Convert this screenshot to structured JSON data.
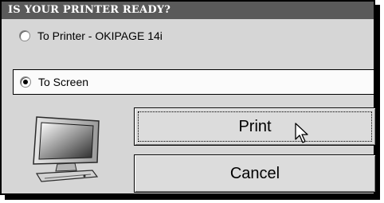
{
  "dialog": {
    "title": "IS YOUR PRINTER READY?"
  },
  "options": [
    {
      "label": "To Printer  -  OKIPAGE 14i",
      "selected": false
    },
    {
      "label": "To Screen",
      "selected": true
    }
  ],
  "buttons": {
    "print_label": "Print",
    "cancel_label": "Cancel"
  },
  "icons": {
    "monitor": "monitor-icon",
    "cursor": "mouse-pointer-icon"
  },
  "colors": {
    "title_bar": "#5a5a5a",
    "dialog_background": "#d6d6d6"
  }
}
